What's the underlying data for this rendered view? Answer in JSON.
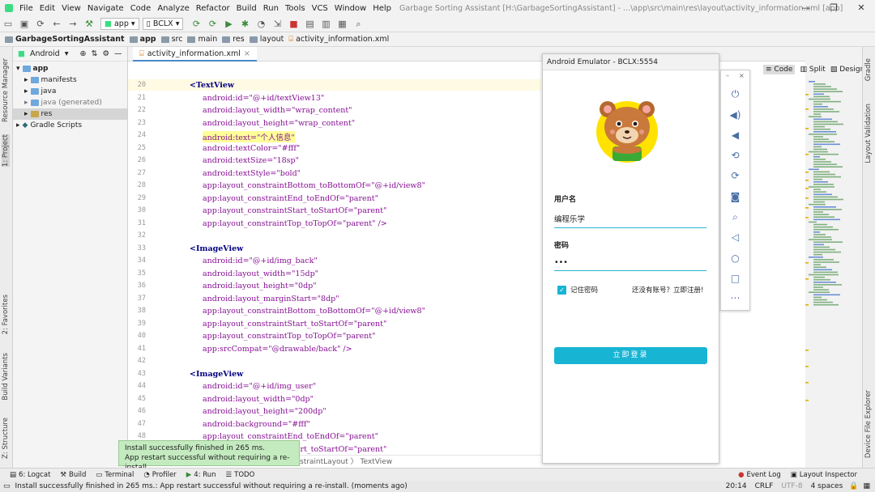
{
  "menu": {
    "items": [
      "File",
      "Edit",
      "View",
      "Navigate",
      "Code",
      "Analyze",
      "Refactor",
      "Build",
      "Run",
      "Tools",
      "VCS",
      "Window",
      "Help"
    ],
    "title": "Garbage Sorting Assistant [H:\\GarbageSortingAssistant] - ...\\app\\src\\main\\res\\layout\\activity_information.xml [app]"
  },
  "window_controls": {
    "minimize": "—",
    "restore": "❐",
    "close": "✕"
  },
  "toolbar": {
    "run_config": "app",
    "device": "BCLX"
  },
  "breadcrumbs": [
    "GarbageSortingAssistant",
    "app",
    "src",
    "main",
    "res",
    "layout",
    "activity_information.xml"
  ],
  "project": {
    "view": "Android",
    "tree": [
      {
        "label": "app",
        "depth": 0
      },
      {
        "label": "manifests",
        "depth": 1
      },
      {
        "label": "java",
        "depth": 1
      },
      {
        "label": "java (generated)",
        "depth": 1
      },
      {
        "label": "res",
        "depth": 1
      },
      {
        "label": "Gradle Scripts",
        "depth": 0
      }
    ]
  },
  "left_tools": [
    "Resource Manager",
    "1: Project",
    "2: Favorites",
    "Build Variants",
    "Z: Structure"
  ],
  "right_tools": [
    "Gradle",
    "Layout Validation",
    "Device File Explorer"
  ],
  "editor": {
    "tab": "activity_information.xml",
    "view_modes": [
      "Code",
      "Split",
      "Design"
    ],
    "lines": [
      {
        "n": "20",
        "t": "<TextView",
        "k": "tag"
      },
      {
        "n": "21",
        "t": "android:id=\"@+id/textView13\""
      },
      {
        "n": "22",
        "t": "android:layout_width=\"wrap_content\""
      },
      {
        "n": "23",
        "t": "android:layout_height=\"wrap_content\""
      },
      {
        "n": "24",
        "t": "android:text=\"个人信息\"",
        "hl": true
      },
      {
        "n": "25",
        "t": "android:textColor=\"#fff\""
      },
      {
        "n": "26",
        "t": "android:textSize=\"18sp\""
      },
      {
        "n": "27",
        "t": "android:textStyle=\"bold\""
      },
      {
        "n": "28",
        "t": "app:layout_constraintBottom_toBottomOf=\"@+id/view8\""
      },
      {
        "n": "29",
        "t": "app:layout_constraintEnd_toEndOf=\"parent\""
      },
      {
        "n": "30",
        "t": "app:layout_constraintStart_toStartOf=\"parent\""
      },
      {
        "n": "31",
        "t": "app:layout_constraintTop_toTopOf=\"parent\" />"
      },
      {
        "n": "32",
        "t": ""
      },
      {
        "n": "33",
        "t": "<ImageView",
        "k": "tag"
      },
      {
        "n": "34",
        "t": "android:id=\"@+id/img_back\""
      },
      {
        "n": "35",
        "t": "android:layout_width=\"15dp\""
      },
      {
        "n": "36",
        "t": "android:layout_height=\"0dp\""
      },
      {
        "n": "37",
        "t": "android:layout_marginStart=\"8dp\""
      },
      {
        "n": "38",
        "t": "app:layout_constraintBottom_toBottomOf=\"@+id/view8\""
      },
      {
        "n": "39",
        "t": "app:layout_constraintStart_toStartOf=\"parent\""
      },
      {
        "n": "40",
        "t": "app:layout_constraintTop_toTopOf=\"parent\""
      },
      {
        "n": "41",
        "t": "app:srcCompat=\"@drawable/back\" />"
      },
      {
        "n": "42",
        "t": ""
      },
      {
        "n": "43",
        "t": "<ImageView",
        "k": "tag"
      },
      {
        "n": "44",
        "t": "android:id=\"@+id/img_user\""
      },
      {
        "n": "45",
        "t": "android:layout_width=\"0dp\""
      },
      {
        "n": "46",
        "t": "android:layout_height=\"200dp\""
      },
      {
        "n": "47",
        "t": "android:background=\"#fff\""
      },
      {
        "n": "48",
        "t": "app:layout_constraintEnd_toEndOf=\"parent\""
      },
      {
        "n": "49",
        "t": "app:layout_constraintStart_toStartOf=\"parent\""
      }
    ],
    "breadcrumb_tail": [
      "straintLayout",
      "TextView"
    ]
  },
  "emulator": {
    "title": "Android Emulator - BCLX:5554",
    "username_label": "用户名",
    "username_value": "编程乐学",
    "password_label": "密码",
    "password_value": "•••",
    "remember_label": "记住密码",
    "register_link": "还没有账号？立即注册!",
    "login_button": "立即登录"
  },
  "toast": {
    "line1": "Install successfully finished in 265 ms.",
    "line2": "App restart successful without requiring a re-install."
  },
  "bottom_tools": [
    "6: Logcat",
    "Build",
    "Terminal",
    "Profiler",
    "4: Run",
    "TODO"
  ],
  "bottom_right_tools": [
    "Event Log",
    "Layout Inspector"
  ],
  "status": {
    "message": "Install successfully finished in 265 ms.: App restart successful without requiring a re-install. (moments ago)",
    "position": "20:14",
    "line_sep": "CRLF",
    "encoding": "UTF-8",
    "indent": "4 spaces"
  }
}
